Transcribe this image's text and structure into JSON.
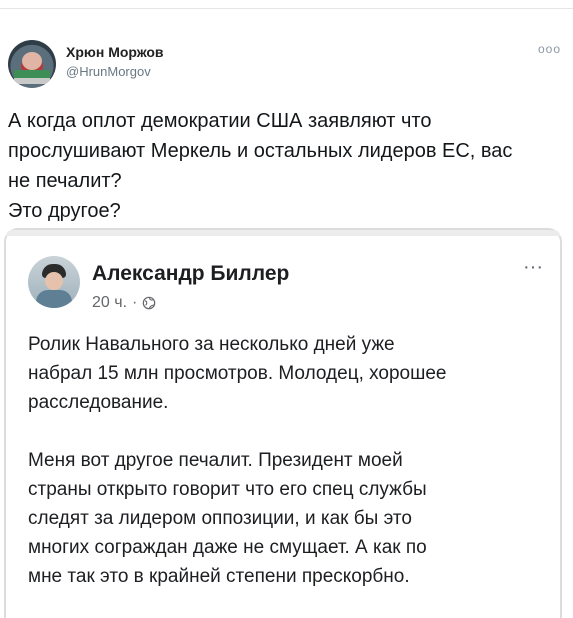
{
  "tweet": {
    "author_name": "Хрюн Моржов",
    "author_handle": "@HrunMorgov",
    "more_label": "ooo",
    "text_lines": [
      "А когда оплот демократии США заявляют что",
      "прослушивают Меркель и остальных лидеров ЕС, вас",
      "не печалит?",
      "Это другое?"
    ]
  },
  "quoted_post": {
    "author_name": "Александр Биллер",
    "time": "20 ч.",
    "separator": "·",
    "more_label": "···",
    "paragraph1_lines": [
      "Ролик Навального за несколько дней уже",
      "набрал 15 млн просмотров. Молодец,  хорошее",
      "расследование."
    ],
    "paragraph2_lines": [
      "Меня вот другое печалит. Президент моей",
      "страны открыто говорит что его спец службы",
      "следят за лидером оппозиции, и как бы это",
      "многих сограждан даже не смущает. А как по",
      "мне так это в крайней степени прескорбно."
    ]
  }
}
